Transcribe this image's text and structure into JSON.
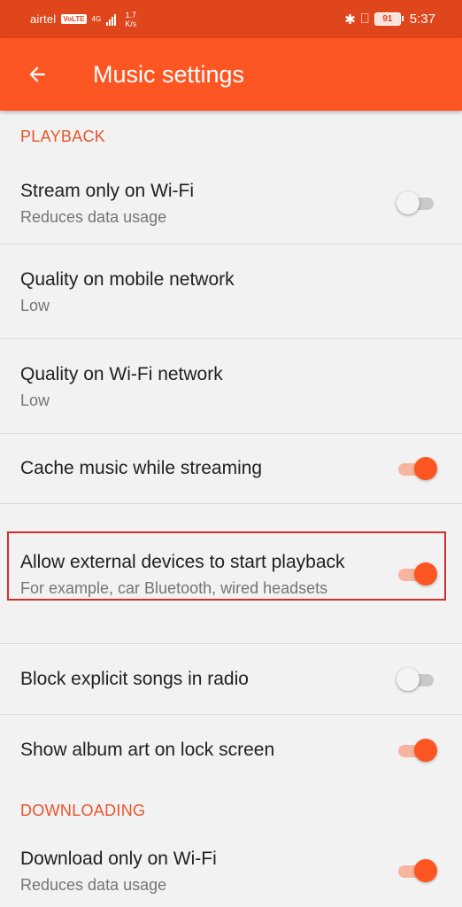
{
  "status_bar": {
    "carrier": "airtel",
    "volte": "VoLTE",
    "network": "4G",
    "speed_value": "1.7",
    "speed_unit": "K/s",
    "battery": "91",
    "time": "5:37"
  },
  "app_bar": {
    "title": "Music settings",
    "back_icon": "arrow-back-icon",
    "color": "#fe5622"
  },
  "playback": {
    "header": "PLAYBACK",
    "items": [
      {
        "title": "Stream only on Wi-Fi",
        "subtitle": "Reduces data usage",
        "toggle": false
      },
      {
        "title": "Quality on mobile network",
        "subtitle": "Low"
      },
      {
        "title": "Quality on Wi-Fi network",
        "subtitle": "Low"
      },
      {
        "title": "Cache music while streaming",
        "toggle": true
      },
      {
        "title": "Allow external devices to start playback",
        "subtitle": "For example, car Bluetooth, wired headsets",
        "toggle": true
      },
      {
        "title": "Block explicit songs in radio",
        "toggle": false
      },
      {
        "title": "Show album art on lock screen",
        "toggle": true
      }
    ]
  },
  "downloading": {
    "header": "DOWNLOADING",
    "items": [
      {
        "title": "Download only on Wi-Fi",
        "subtitle": "Reduces data usage",
        "toggle": true
      }
    ]
  },
  "colors": {
    "accent": "#fe5622",
    "status_bar": "#e0461b",
    "highlight": "#d32f2f"
  }
}
